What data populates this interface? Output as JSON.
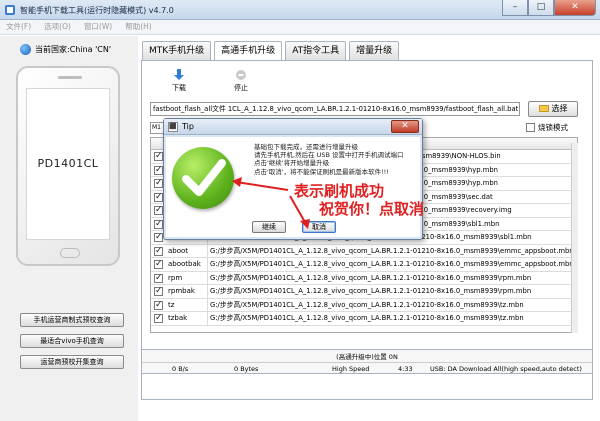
{
  "window": {
    "title": "智能手机下载工具(运行时隐藏模式)  v4.7.0",
    "minimize": "–",
    "maximize": "□",
    "close": "✕"
  },
  "menu": [
    "文件(F)",
    "选项(O)",
    "窗口(W)",
    "帮助(H)"
  ],
  "left_panel": {
    "country_label": "当前国家:China 'CN'",
    "phone_model": "PD1401CL",
    "buttons": [
      "手机运营商制式预校查询",
      "最适合vivo手机查询",
      "运营商预校开集查询"
    ]
  },
  "tabs": [
    {
      "label": "MTK手机升级"
    },
    {
      "label": "高通手机升级"
    },
    {
      "label": "AT指令工具"
    },
    {
      "label": "增量升级"
    }
  ],
  "toolbar": {
    "download_label": "下载",
    "stop_label": "停止"
  },
  "path": {
    "value": "fastboot_flash_all文件    1CL_A_1.12.8_vivo_qcom_LA.BR.1.2.1-01210-8x16.0_msm8939/fastboot_flash_all.bat",
    "select_label": "选择",
    "mini_value": "M1",
    "safe_mode_label": "烧锁模式"
  },
  "file_rows": [
    {
      "name": "",
      "path": "\\msm8939\\NON-HLOS.bin"
    },
    {
      "name": "",
      "path": "16.0_msm8939\\hyp.mbn"
    },
    {
      "name": "",
      "path": "16.0_msm8939\\hyp.mbn"
    },
    {
      "name": "",
      "path": "16.0_msm8939\\sec.dat"
    },
    {
      "name": "",
      "path": "16.0_msm8939\\recovery.img"
    },
    {
      "name": "",
      "path": "16.0_msm8939\\sbl1.mbn"
    },
    {
      "name": "sbl1bak",
      "path": "G:/步步高/X5M/PD1401CL_A_1.12.8_vivo_qcom_LA.BR.1.2.1-01210-8x16.0_msm8939\\sbl1.mbn"
    },
    {
      "name": "aboot",
      "path": "G:/步步高/X5M/PD1401CL_A_1.12.8_vivo_qcom_LA.BR.1.2.1-01210-8x16.0_msm8939\\emmc_appsboot.mbn"
    },
    {
      "name": "abootbak",
      "path": "G:/步步高/X5M/PD1401CL_A_1.12.8_vivo_qcom_LA.BR.1.2.1-01210-8x16.0_msm8939\\emmc_appsboot.mbn"
    },
    {
      "name": "rpm",
      "path": "G:/步步高/X5M/PD1401CL_A_1.12.8_vivo_qcom_LA.BR.1.2.1-01210-8x16.0_msm8939\\rpm.mbn"
    },
    {
      "name": "rpmbak",
      "path": "G:/步步高/X5M/PD1401CL_A_1.12.8_vivo_qcom_LA.BR.1.2.1-01210-8x16.0_msm8939\\rpm.mbn"
    },
    {
      "name": "tz",
      "path": "G:/步步高/X5M/PD1401CL_A_1.12.8_vivo_qcom_LA.BR.1.2.1-01210-8x16.0_msm8939\\tz.mbn"
    },
    {
      "name": "tzbak",
      "path": "G:/步步高/X5M/PD1401CL_A_1.12.8_vivo_qcom_LA.BR.1.2.1-01210-8x16.0_msm8939\\tz.mbn"
    }
  ],
  "status": {
    "message": "(高通升级中)位置 0N",
    "speed": "0 B/s",
    "bytes": "0 Bytes",
    "mode": "High Speed",
    "time": "4:33",
    "port": "USB: DA Download All(high speed,auto detect)"
  },
  "dialog": {
    "title": "Tip",
    "lines": [
      "基础包下载完成，还需进行增量升级",
      "请先手机开机,然后在 USB 设置中打开手机调试端口",
      "点击'继续'将开始增量升级",
      "点击'取消'，将不能保证刷机是最新版本软件!!!"
    ],
    "continue_label": "继续",
    "cancel_label": "取消",
    "close_label": "✕"
  },
  "annotation": {
    "line1": "表示刷机成功",
    "line2": "祝贺你！点取消",
    "color": "#e02020"
  }
}
